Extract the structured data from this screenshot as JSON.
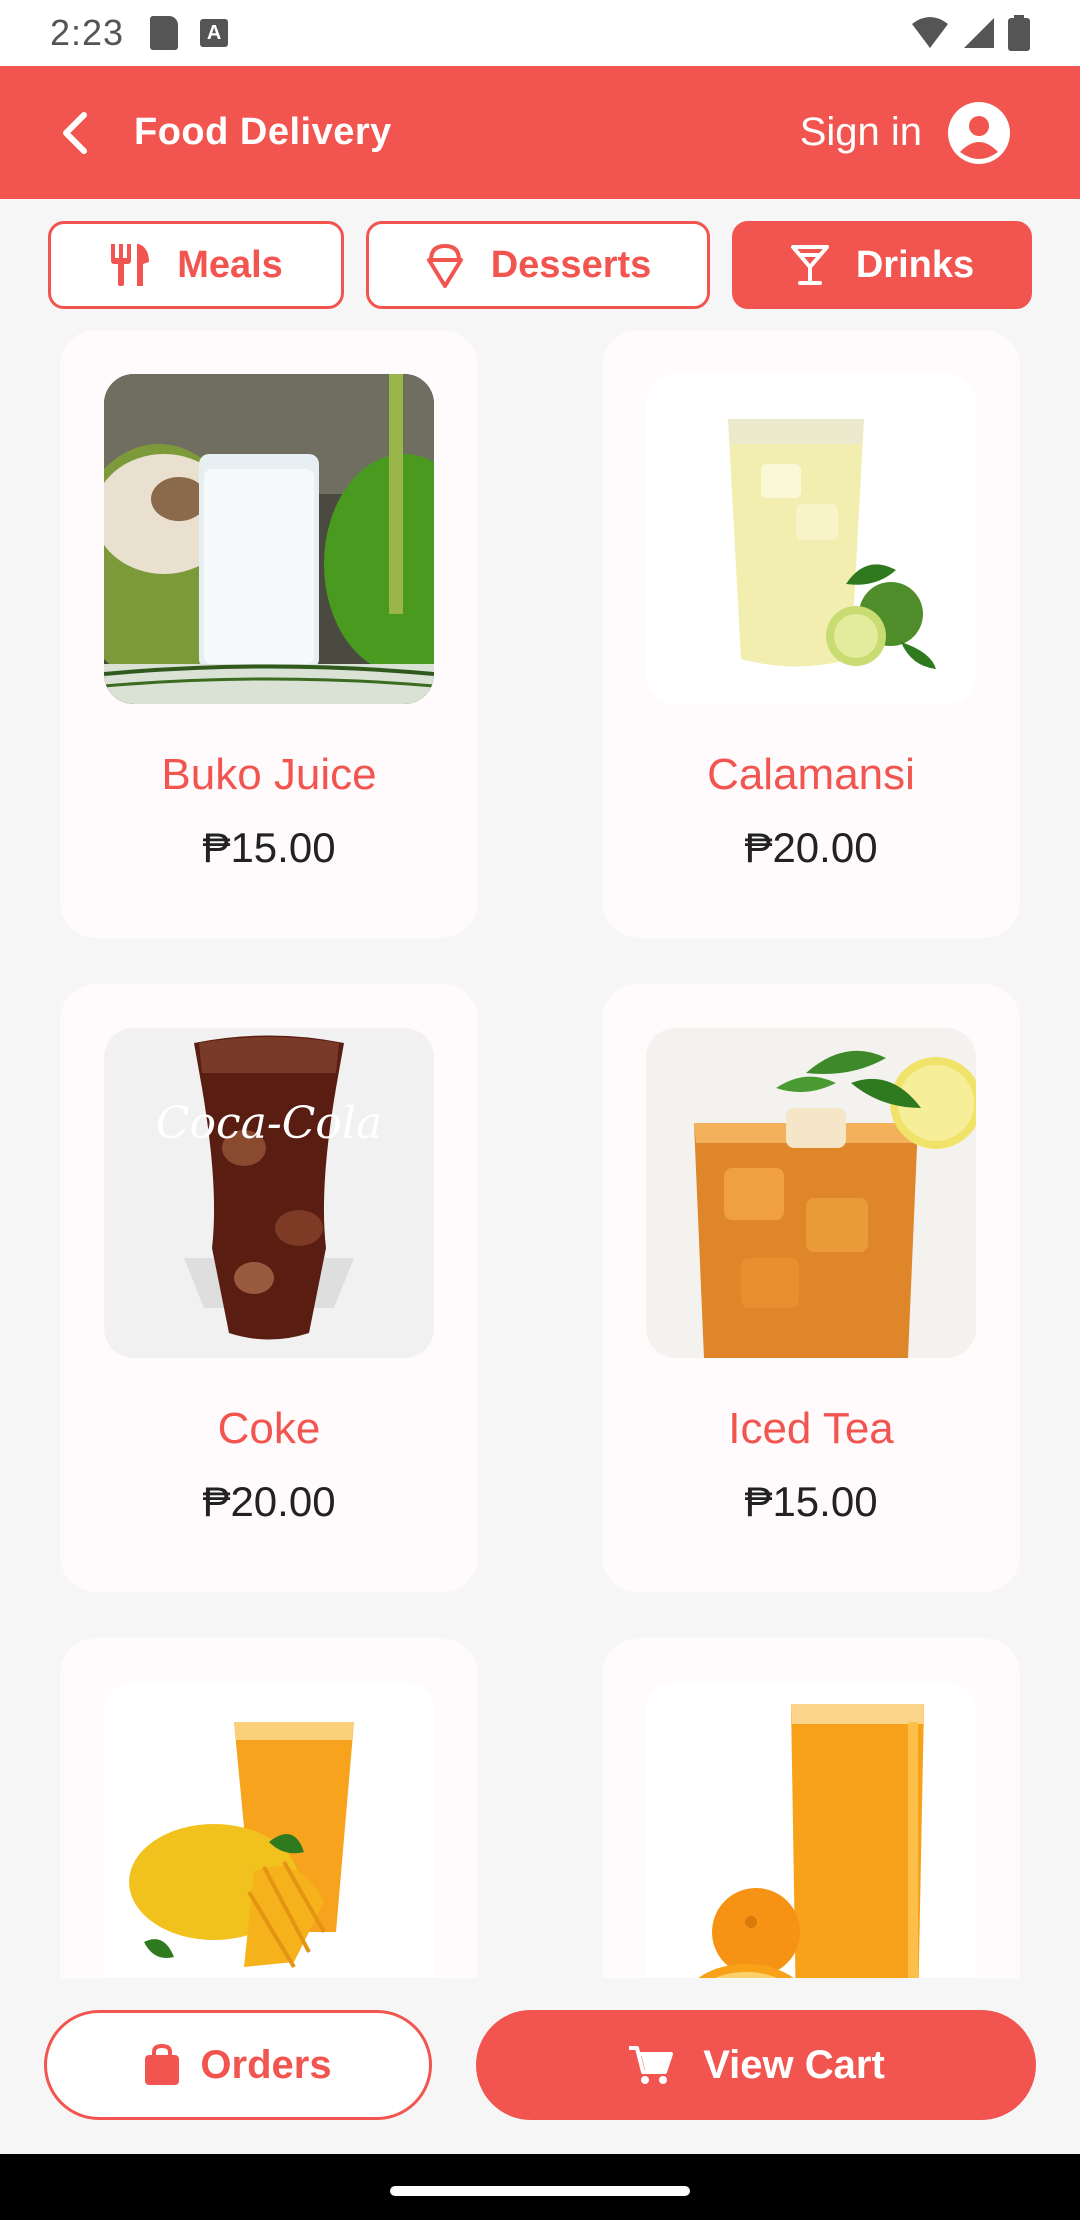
{
  "status_bar": {
    "time": "2:23",
    "icons": [
      "sd-card-icon",
      "a-notification-icon",
      "wifi-icon",
      "signal-icon",
      "battery-icon"
    ],
    "a_glyph": "A"
  },
  "app_bar": {
    "title": "Food Delivery",
    "sign_in_label": "Sign in",
    "background_color": "#f2554f"
  },
  "tabs": [
    {
      "label": "Meals",
      "icon": "fork-knife-icon",
      "active": false
    },
    {
      "label": "Desserts",
      "icon": "ice-cream-icon",
      "active": false
    },
    {
      "label": "Drinks",
      "icon": "cocktail-glass-icon",
      "active": true
    }
  ],
  "products": [
    {
      "name": "Buko Juice",
      "price": "₱15.00"
    },
    {
      "name": "Calamansi",
      "price": "₱20.00"
    },
    {
      "name": "Coke",
      "price": "₱20.00"
    },
    {
      "name": "Iced Tea",
      "price": "₱15.00"
    },
    {
      "name": "",
      "price": ""
    },
    {
      "name": "",
      "price": ""
    }
  ],
  "actions": {
    "orders_label": "Orders",
    "view_cart_label": "View Cart"
  },
  "colors": {
    "accent": "#f2554f",
    "card_bg": "#fffbfc",
    "page_bg": "#f6f6f6"
  }
}
